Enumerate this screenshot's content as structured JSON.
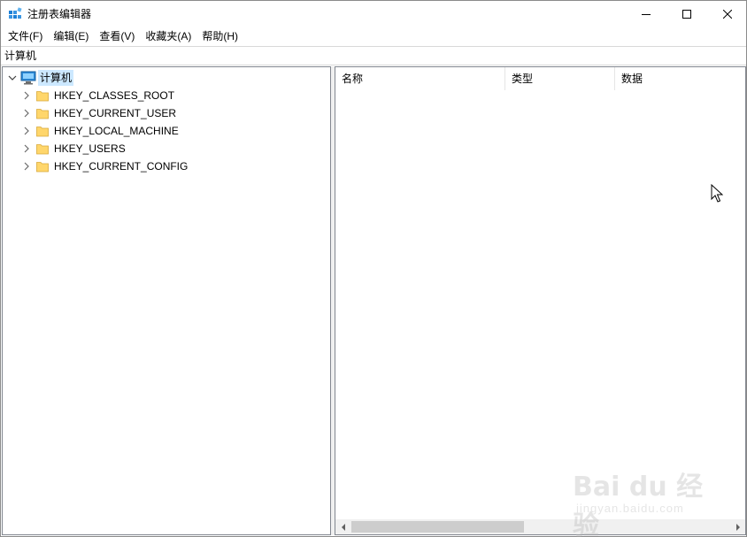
{
  "window": {
    "title": "注册表编辑器"
  },
  "menu": {
    "items": [
      "文件(F)",
      "编辑(E)",
      "查看(V)",
      "收藏夹(A)",
      "帮助(H)"
    ]
  },
  "address": {
    "path": "计算机"
  },
  "tree": {
    "root": "计算机",
    "children": [
      "HKEY_CLASSES_ROOT",
      "HKEY_CURRENT_USER",
      "HKEY_LOCAL_MACHINE",
      "HKEY_USERS",
      "HKEY_CURRENT_CONFIG"
    ]
  },
  "list": {
    "columns": [
      "名称",
      "类型",
      "数据"
    ]
  },
  "watermark": {
    "logo": "Bai du 经验",
    "sub": "jingyan.baidu.com"
  },
  "colors": {
    "selection": "#cce8ff",
    "folder": "#ffd66b",
    "accent": "#0078d7"
  }
}
